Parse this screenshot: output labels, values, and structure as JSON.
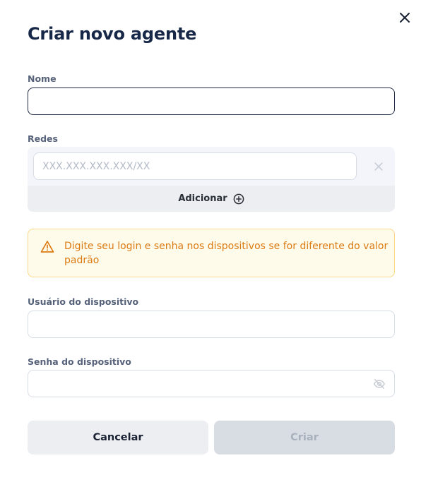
{
  "modal": {
    "title": "Criar novo agente",
    "close_icon": "close-icon"
  },
  "fields": {
    "nome": {
      "label": "Nome",
      "value": "",
      "placeholder": ""
    },
    "redes": {
      "label": "Redes",
      "items": [
        {
          "value": "",
          "placeholder": "XXX.XXX.XXX.XXX/XX"
        }
      ],
      "add_label": "Adicionar",
      "add_icon": "plus-circle-icon",
      "remove_icon": "close-icon"
    },
    "usuario": {
      "label": "Usuário do dispositivo",
      "value": "",
      "placeholder": ""
    },
    "senha": {
      "label": "Senha do dispositivo",
      "value": "",
      "placeholder": "",
      "toggle_icon": "eye-off-icon"
    }
  },
  "warning": {
    "icon": "warning-triangle-icon",
    "text": "Digite seu login e senha nos dispositivos se for diferente do valor padrão"
  },
  "actions": {
    "cancel_label": "Cancelar",
    "create_label": "Criar",
    "create_disabled": true
  },
  "colors": {
    "title": "#172747",
    "label": "#56627a",
    "warning_text": "#dc7a12",
    "warning_border": "#fbd98a",
    "warning_bg": "#fffbeb",
    "disabled_button": "#d8dde4"
  }
}
